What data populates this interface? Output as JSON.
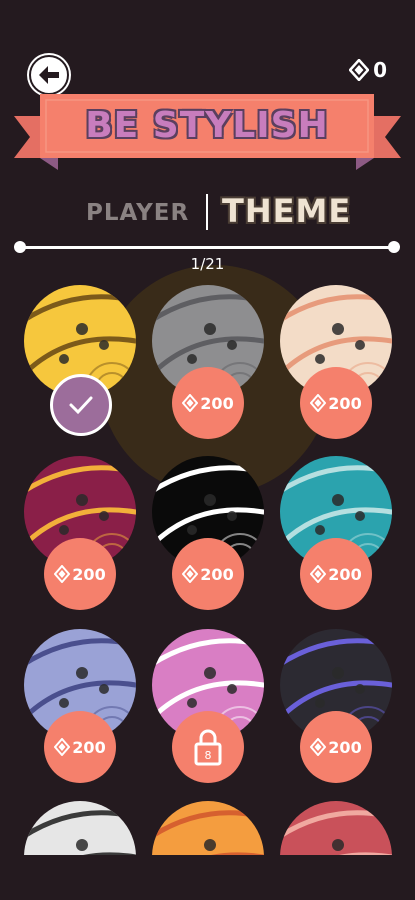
{
  "header": {
    "back_icon": "arrow-left-icon",
    "gem_icon": "diamond-icon",
    "gem_count": "0"
  },
  "banner": {
    "title": "BE STYLISH"
  },
  "tabs": {
    "player": "PLAYER",
    "theme": "THEME"
  },
  "pager": {
    "counter": "1/21"
  },
  "themes": [
    {
      "name": "yellow",
      "base": "#f6c73d",
      "stripe": "#7c5a1a",
      "state": "selected"
    },
    {
      "name": "gray",
      "base": "#8e8e90",
      "stripe": "#5e5e62",
      "state": "price",
      "price": "200"
    },
    {
      "name": "cream",
      "base": "#f3dcc7",
      "stripe": "#e79b7c",
      "state": "price",
      "price": "200"
    },
    {
      "name": "crimson",
      "base": "#8a1f48",
      "stripe": "#f2b03a",
      "state": "price",
      "price": "200"
    },
    {
      "name": "black",
      "base": "#0a0a0a",
      "stripe": "#ffffff",
      "state": "price",
      "price": "200"
    },
    {
      "name": "teal",
      "base": "#2ba3ae",
      "stripe": "#b5dfe0",
      "state": "price",
      "price": "200"
    },
    {
      "name": "periwinkle",
      "base": "#9aa2d6",
      "stripe": "#4a4f8e",
      "state": "price",
      "price": "200"
    },
    {
      "name": "pink",
      "base": "#d97ec4",
      "stripe": "#ffffff",
      "state": "locked",
      "lock_number": "8"
    },
    {
      "name": "charcoal",
      "base": "#2c2a32",
      "stripe": "#6a60d9",
      "state": "price",
      "price": "200"
    },
    {
      "name": "silver",
      "base": "#e6e6e6",
      "stripe": "#3a3a3a",
      "state": "partial"
    },
    {
      "name": "orange",
      "base": "#f49d3f",
      "stripe": "#d6602f",
      "state": "partial"
    },
    {
      "name": "coral",
      "base": "#c9515a",
      "stripe": "#f0a9a0",
      "state": "partial"
    }
  ]
}
